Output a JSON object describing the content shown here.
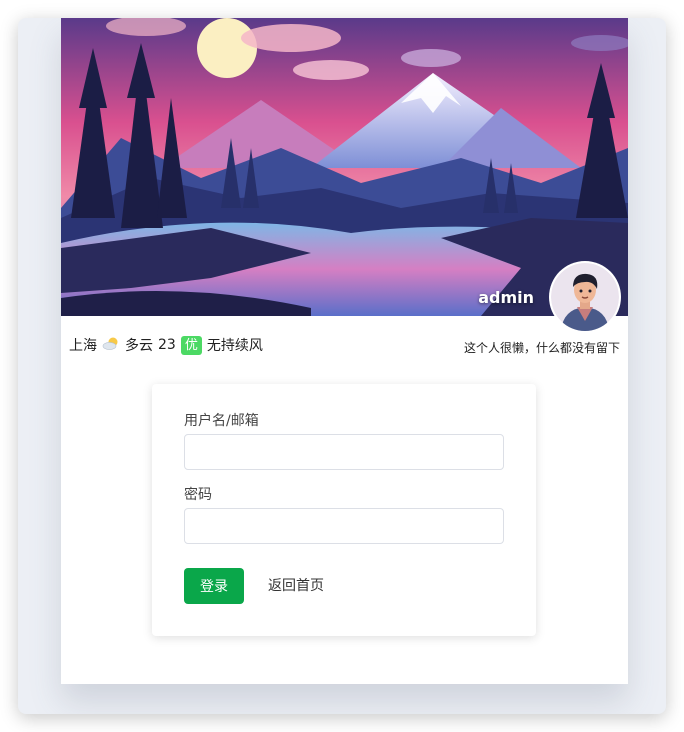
{
  "profile": {
    "username": "admin",
    "signature": "这个人很懒，什么都没有留下"
  },
  "weather": {
    "city": "上海",
    "icon": "partly-cloudy-icon",
    "condition": "多云",
    "temperature": "23",
    "aqi": "优",
    "wind": "无持续风"
  },
  "login": {
    "username_label": "用户名/邮箱",
    "username_value": "",
    "password_label": "密码",
    "password_value": "",
    "submit_label": "登录",
    "back_label": "返回首页"
  },
  "colors": {
    "primary_button": "#0aa74a",
    "aqi_badge": "#4cd964"
  }
}
